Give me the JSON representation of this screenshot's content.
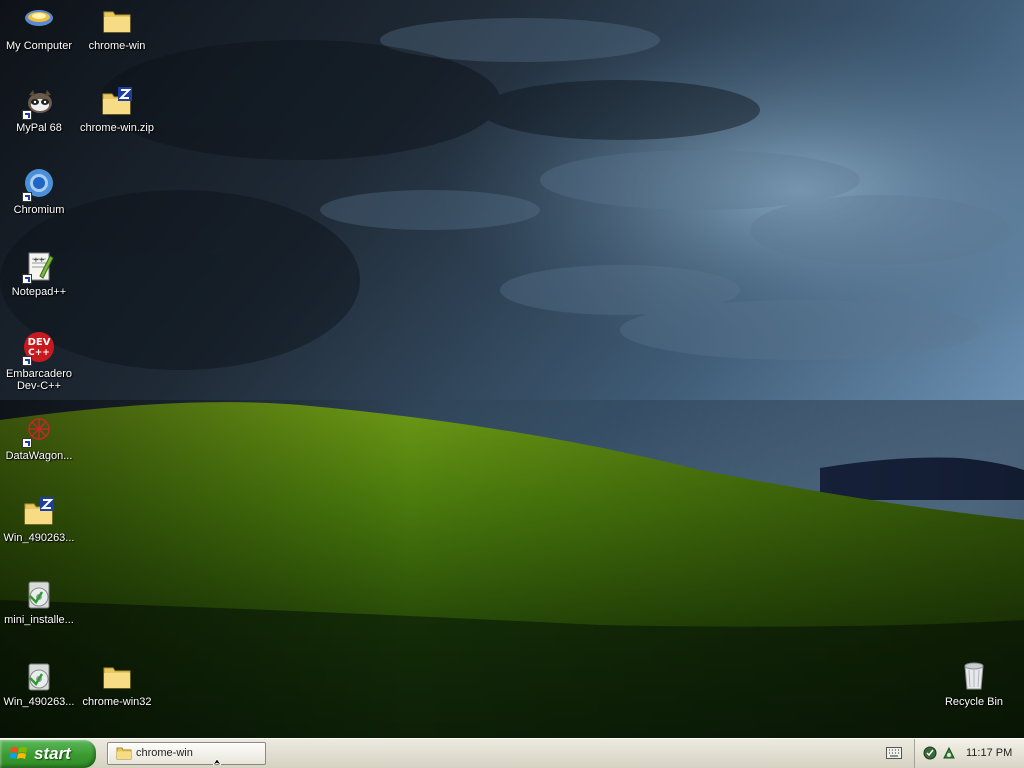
{
  "desktop": {
    "icons": [
      {
        "label": "My Computer",
        "icon": "my-computer-icon"
      },
      {
        "label": "chrome-win",
        "icon": "folder-icon"
      },
      {
        "label": "MyPal 68",
        "icon": "mypal-icon"
      },
      {
        "label": "chrome-win.zip",
        "icon": "zip-folder-icon"
      },
      {
        "label": "Chromium",
        "icon": "chromium-icon"
      },
      {
        "label": "Notepad++",
        "icon": "notepad-plus-plus-icon"
      },
      {
        "label": "Embarcadero Dev-C++",
        "icon": "dev-cpp-icon"
      },
      {
        "label": "DataWagon...",
        "icon": "datawagon-icon"
      },
      {
        "label": "Win_490263...",
        "icon": "zip-folder-icon"
      },
      {
        "label": "mini_installe...",
        "icon": "installer-icon"
      },
      {
        "label": "Win_490263...",
        "icon": "installer-icon"
      },
      {
        "label": "chrome-win32",
        "icon": "folder-icon"
      },
      {
        "label": "Recycle Bin",
        "icon": "recycle-bin-icon"
      }
    ],
    "devcpp_badge": "DEV\nC++"
  },
  "taskbar": {
    "start_label": "start",
    "task_button_label": "chrome-win",
    "clock": "11:17 PM"
  },
  "colors": {
    "start_green": "#3a9a2f",
    "taskbar_bg": "#dedbcd"
  }
}
